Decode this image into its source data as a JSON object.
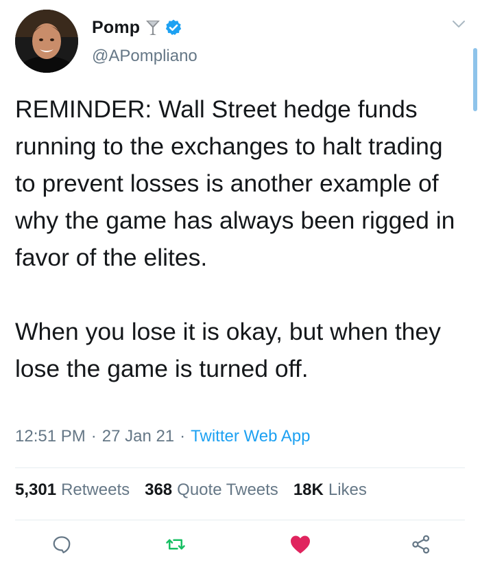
{
  "author": {
    "display_name": "Pomp",
    "handle": "@APompliano",
    "badge_icon": "martini-glass-icon",
    "verified_icon": "verified-badge-icon"
  },
  "tweet": {
    "paragraph_1": "REMINDER: Wall Street hedge funds running to the exchanges to halt trading to prevent losses is another example of why the game has always been rigged in favor of the elites.",
    "paragraph_2": "When you lose it is okay, but when they lose the game is turned off.",
    "time": "12:51 PM",
    "separator": "·",
    "date": "27 Jan 21",
    "source": "Twitter Web App"
  },
  "stats": {
    "retweets_count": "5,301",
    "retweets_label": "Retweets",
    "quotes_count": "368",
    "quotes_label": "Quote Tweets",
    "likes_count": "18K",
    "likes_label": "Likes"
  },
  "actions": {
    "reply_icon": "reply-bubble-icon",
    "retweet_icon": "retweet-icon",
    "like_icon": "heart-icon",
    "share_icon": "share-icon"
  },
  "colors": {
    "text": "#14171a",
    "muted": "#657786",
    "link": "#1da1f2",
    "retweet_green": "#17bf63",
    "like_red": "#e0245e"
  }
}
